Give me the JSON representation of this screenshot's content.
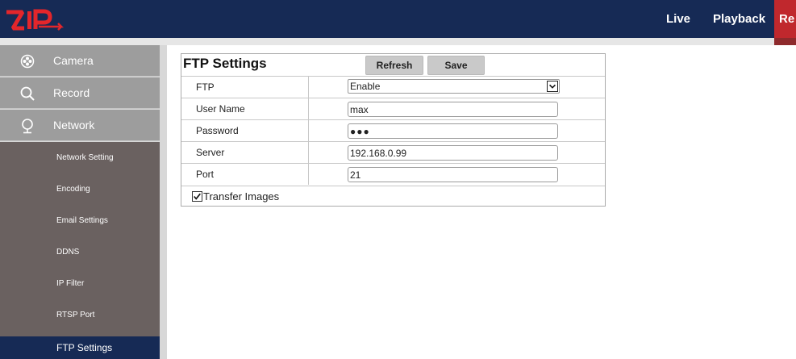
{
  "header": {
    "logo_text": "ZIP",
    "nav": [
      {
        "label": "Live"
      },
      {
        "label": "Playback"
      },
      {
        "label": "Re"
      }
    ]
  },
  "sidebar": {
    "main_items": [
      {
        "label": "Camera",
        "icon": "camera-icon"
      },
      {
        "label": "Record",
        "icon": "search-icon"
      },
      {
        "label": "Network",
        "icon": "network-icon"
      }
    ],
    "sub_items": [
      {
        "label": "Network Setting"
      },
      {
        "label": "Encoding"
      },
      {
        "label": "Email Settings"
      },
      {
        "label": "DDNS"
      },
      {
        "label": "IP Filter"
      },
      {
        "label": "RTSP Port"
      },
      {
        "label": "FTP Settings",
        "active": true
      }
    ]
  },
  "ftp": {
    "title": "FTP Settings",
    "refresh_label": "Refresh",
    "save_label": "Save",
    "fields": [
      {
        "label": "FTP",
        "type": "select",
        "value": "Enable"
      },
      {
        "label": "User Name",
        "type": "text",
        "value": "max"
      },
      {
        "label": "Password",
        "type": "password",
        "value": "●●●"
      },
      {
        "label": "Server",
        "type": "text",
        "value": "192.168.0.99"
      },
      {
        "label": "Port",
        "type": "text",
        "value": "21"
      }
    ],
    "transfer_images_label": "Transfer Images",
    "transfer_images_checked": true
  },
  "colors": {
    "topbar": "#162a55",
    "accent_red": "#c0282d",
    "sidebar_main": "#9d9d9d",
    "sidebar_sub": "#6a6160",
    "active_item": "#162a55"
  }
}
